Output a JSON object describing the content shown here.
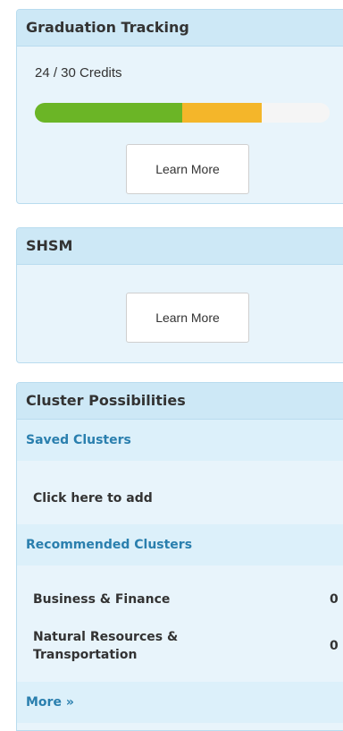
{
  "graduation": {
    "title": "Graduation Tracking",
    "credits_text": "24 / 30 Credits",
    "progress": {
      "segments": [
        {
          "name": "earned",
          "fraction": 0.5,
          "color": "#6bb526"
        },
        {
          "name": "in-progress",
          "fraction": 0.27,
          "color": "#f4b62a"
        },
        {
          "name": "remaining",
          "fraction": 0.23,
          "color": "#f5f5f5"
        }
      ]
    },
    "learn_more_label": "Learn More"
  },
  "shsm": {
    "title": "SHSM",
    "learn_more_label": "Learn More"
  },
  "clusters": {
    "title": "Cluster Possibilities",
    "saved_header": "Saved Clusters",
    "saved_add_text": "Click here to add",
    "recommended_header": "Recommended Clusters",
    "recommended": [
      {
        "name": "Business & Finance",
        "value": "0"
      },
      {
        "name": "Natural Resources & Transportation",
        "value": "0"
      }
    ],
    "more_label": "More »"
  }
}
